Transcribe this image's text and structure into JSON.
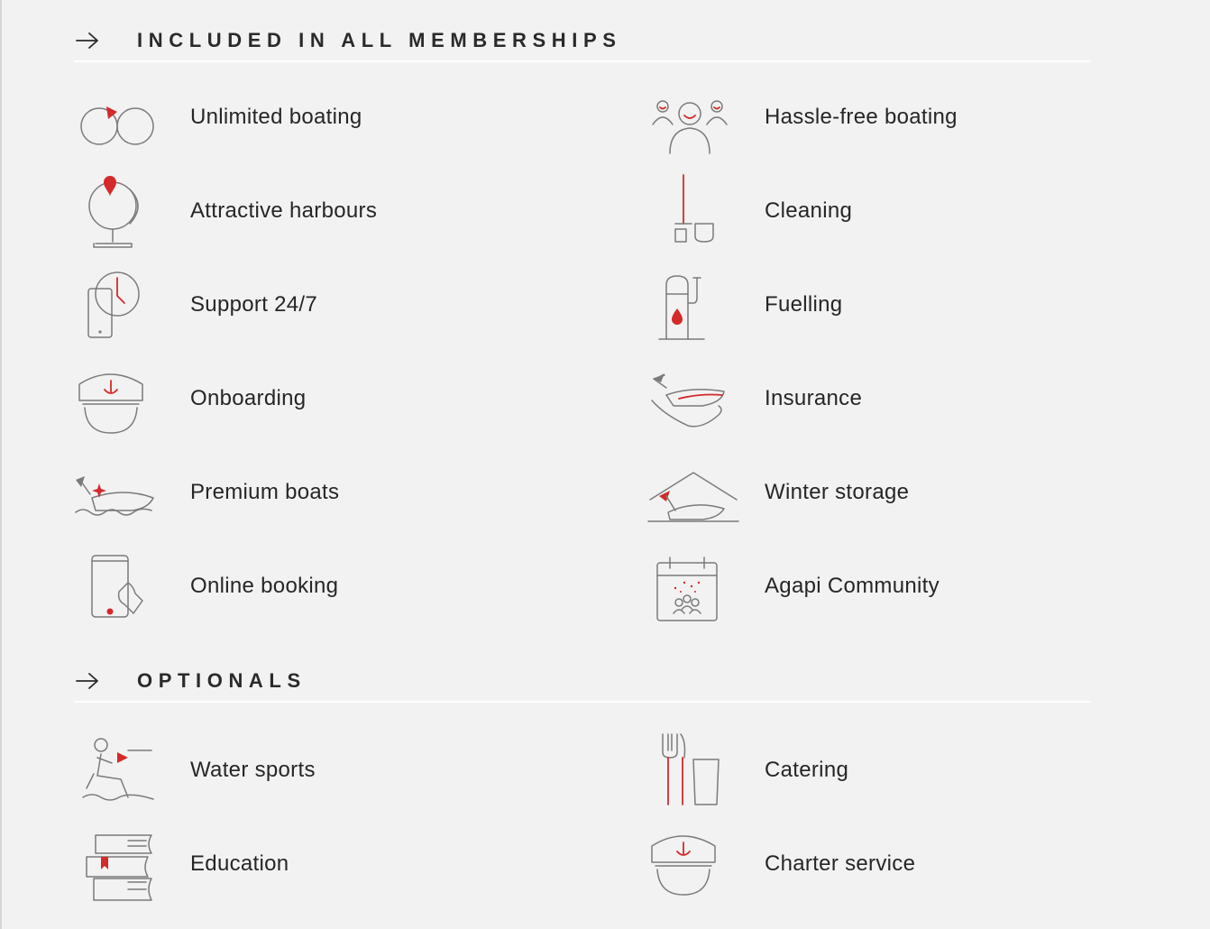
{
  "sections": [
    {
      "title": "INCLUDED IN ALL MEMBERSHIPS",
      "items": [
        {
          "label": "Unlimited boating",
          "icon": "infinity-icon"
        },
        {
          "label": "Hassle-free boating",
          "icon": "people-icon"
        },
        {
          "label": "Attractive harbours",
          "icon": "globe-pin-icon"
        },
        {
          "label": "Cleaning",
          "icon": "mop-bucket-icon"
        },
        {
          "label": "Support 24/7",
          "icon": "phone-clock-icon"
        },
        {
          "label": "Fuelling",
          "icon": "fuel-pump-icon"
        },
        {
          "label": "Onboarding",
          "icon": "captain-hat-icon"
        },
        {
          "label": "Insurance",
          "icon": "hand-boat-icon"
        },
        {
          "label": "Premium boats",
          "icon": "sparkle-boat-icon"
        },
        {
          "label": "Winter storage",
          "icon": "boat-shed-icon"
        },
        {
          "label": "Online booking",
          "icon": "phone-tap-icon"
        },
        {
          "label": "Agapi Community",
          "icon": "calendar-community-icon"
        }
      ]
    },
    {
      "title": "OPTIONALS",
      "items": [
        {
          "label": "Water sports",
          "icon": "water-ski-icon"
        },
        {
          "label": "Catering",
          "icon": "cutlery-glass-icon"
        },
        {
          "label": "Education",
          "icon": "books-icon"
        },
        {
          "label": "Charter service",
          "icon": "captain-hat-icon"
        }
      ]
    }
  ],
  "colors": {
    "accent": "#d42a2a",
    "icon_stroke": "#7b7b7b",
    "background": "#f2f2f2",
    "divider": "#ffffff"
  }
}
